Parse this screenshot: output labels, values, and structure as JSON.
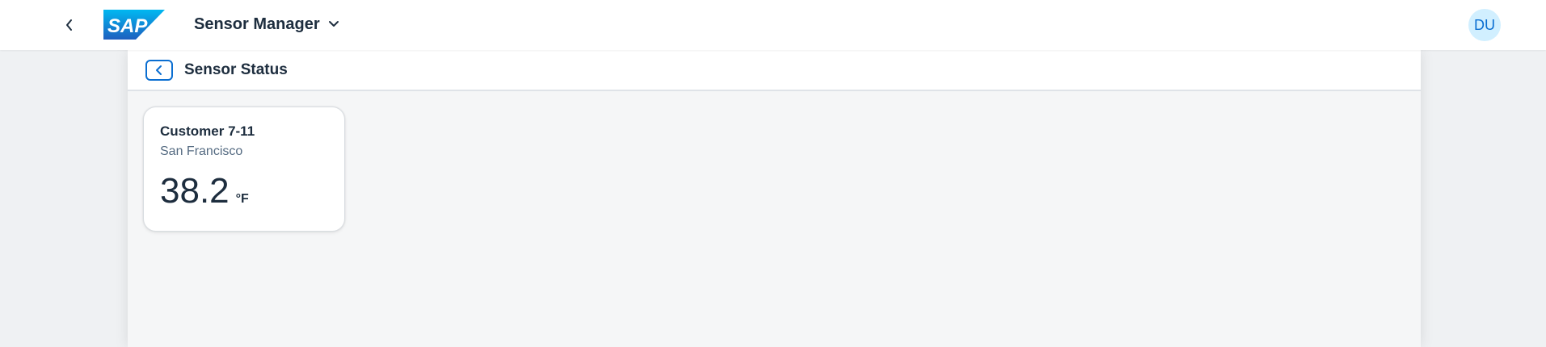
{
  "shell": {
    "logo_text": "SAP",
    "app_title": "Sensor Manager",
    "avatar_initials": "DU",
    "brand_color": "#0a6ed1"
  },
  "page": {
    "title": "Sensor Status"
  },
  "tiles": [
    {
      "title": "Customer 7-11",
      "subtitle": "San Francisco",
      "value": "38.2",
      "unit": "°F"
    }
  ]
}
